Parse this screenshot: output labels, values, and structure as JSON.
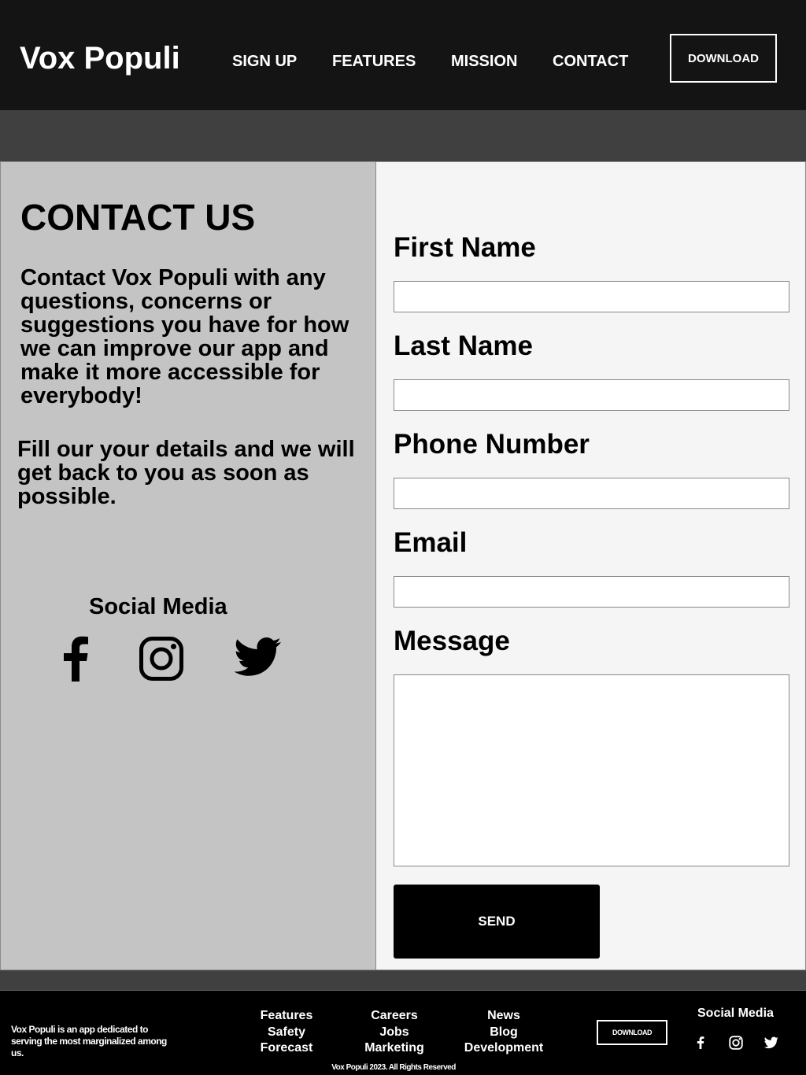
{
  "header": {
    "logo": "Vox Populi",
    "nav": [
      "SIGN UP",
      "FEATURES",
      "MISSION",
      "CONTACT"
    ],
    "download_label": "DOWNLOAD"
  },
  "contact": {
    "title": "CONTACT US",
    "intro": "Contact Vox Populi with any questions, concerns or suggestions you have for how we can improve our app and make it more accessible for everybody!",
    "fill_text": "Fill our your details and we will get back to you as soon as possible.",
    "social_title": "Social Media",
    "social_icons": [
      "facebook-icon",
      "instagram-icon",
      "twitter-icon"
    ]
  },
  "form": {
    "first_name_label": "First Name",
    "first_name_value": "",
    "last_name_label": "Last Name",
    "last_name_value": "",
    "phone_label": "Phone Number",
    "phone_value": "",
    "email_label": "Email",
    "email_value": "",
    "message_label": "Message",
    "message_value": "",
    "send_label": "SEND"
  },
  "footer": {
    "description": "Vox Populi is an app dedicated to serving the most marginalized among us.",
    "col1": [
      "Features",
      "Safety",
      "Forecast"
    ],
    "col2": [
      "Careers",
      "Jobs",
      "Marketing"
    ],
    "col3": [
      "News",
      "Blog",
      "Development"
    ],
    "download_label": "DOWNLOAD",
    "social_title": "Social Media",
    "copyright": "Vox Populi 2023. All Rights Reserved"
  },
  "colors": {
    "header_bg": "#141414",
    "band_bg": "#404040",
    "left_panel_bg": "#c4c4c4",
    "right_panel_bg": "#f5f5f5",
    "button_bg": "#000000"
  }
}
